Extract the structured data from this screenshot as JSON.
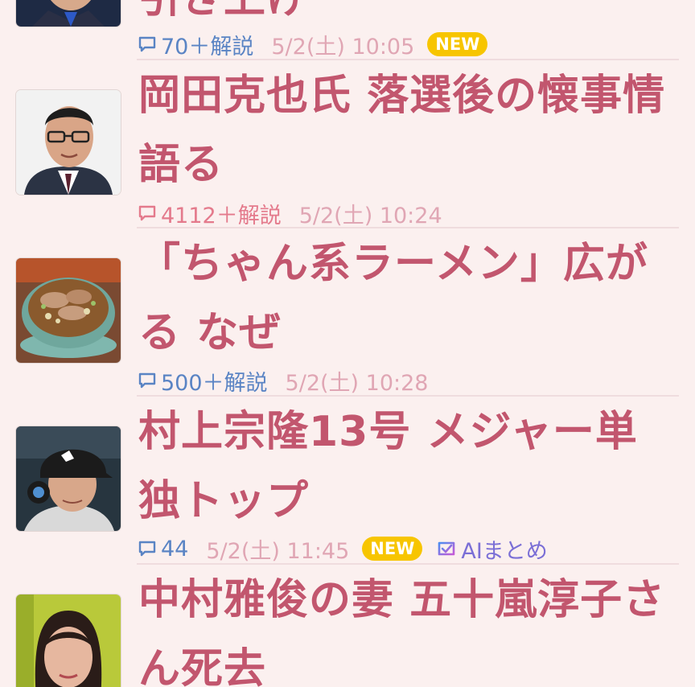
{
  "colors": {
    "background": "#fbf0ef",
    "headline": "#c2566e",
    "comment_count": "#5a84c4",
    "comment_count_hot": "#e47a8c",
    "date": "#e0a6b4",
    "new_badge": "#f7c500",
    "ai_label": "#7b6fd6"
  },
  "articles": [
    {
      "headline": "引き上げ",
      "thumbnail": "politician-photo",
      "comments": "70＋解説",
      "date": "5/2(土) 10:05",
      "badge": "NEW"
    },
    {
      "headline": "岡田克也氏 落選後の懐事情語る",
      "thumbnail": "man-with-glasses-photo",
      "comments": "4112＋解説",
      "date": "5/2(土) 10:24"
    },
    {
      "headline": "「ちゃん系ラーメン」広がる なぜ",
      "thumbnail": "ramen-bowl-photo",
      "comments": "500＋解説",
      "date": "5/2(土) 10:28"
    },
    {
      "headline": "村上宗隆13号 メジャー単独トップ",
      "thumbnail": "baseball-player-photo",
      "comments": "44",
      "date": "5/2(土) 11:45",
      "badge": "NEW",
      "ai_label": "AIまとめ"
    },
    {
      "headline": "中村雅俊の妻 五十嵐淳子さん死去",
      "thumbnail": "woman-portrait-photo"
    }
  ]
}
